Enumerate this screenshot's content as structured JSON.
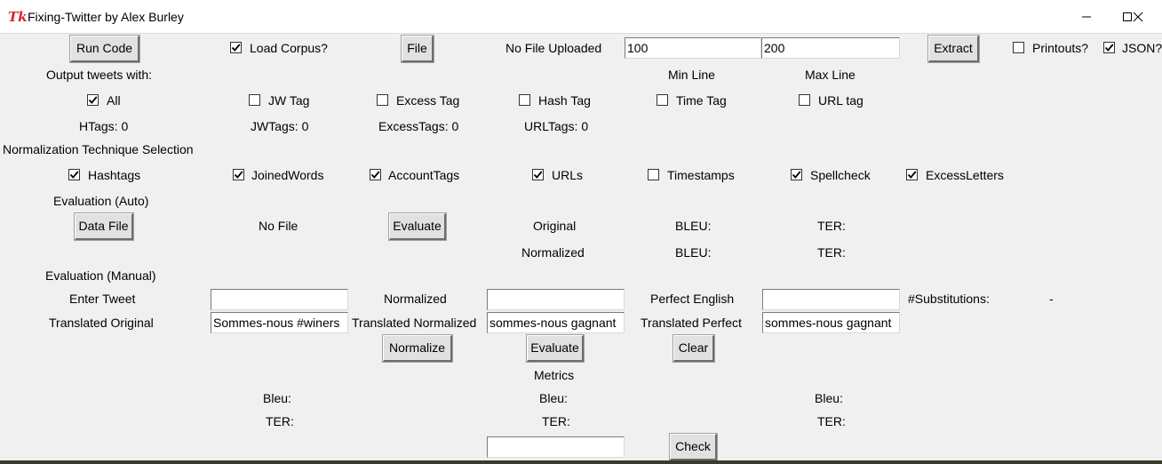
{
  "window": {
    "logo": "Tk",
    "title": "Fixing-Twitter by Alex Burley"
  },
  "row1": {
    "run_code": "Run Code",
    "load_corpus": "Load Corpus?",
    "file_btn": "File",
    "file_status": "No File Uploaded",
    "min_line_value": "100",
    "max_line_value": "200",
    "extract": "Extract",
    "printouts": "Printouts?",
    "json": "JSON?"
  },
  "row2": {
    "output_with": "Output tweets with:",
    "min_line": "Min Line",
    "max_line": "Max Line"
  },
  "tags": {
    "all": "All",
    "jw": "JW Tag",
    "excess": "Excess Tag",
    "hash": "Hash Tag",
    "time": "Time Tag",
    "url": "URL tag"
  },
  "counts": {
    "htags": "HTags: 0",
    "jwtags": "JWTags: 0",
    "excesstags": "ExcessTags: 0",
    "urltags": "URLTags: 0"
  },
  "normalization": {
    "heading": "Normalization Technique Selection",
    "hashtags": "Hashtags",
    "joinedwords": "JoinedWords",
    "accounttags": "AccountTags",
    "urls": "URLs",
    "timestamps": "Timestamps",
    "spellcheck": "Spellcheck",
    "excessletters": "ExcessLetters"
  },
  "eval_auto": {
    "heading": "Evaluation (Auto)",
    "data_file": "Data File",
    "no_file": "No File",
    "evaluate": "Evaluate",
    "original": "Original",
    "normalized": "Normalized",
    "bleu": "BLEU:",
    "ter": "TER:"
  },
  "eval_manual": {
    "heading": "Evaluation (Manual)",
    "enter_tweet": "Enter Tweet",
    "normalized": "Normalized",
    "perfect_english": "Perfect English",
    "substitutions": "#Substitutions:",
    "substitutions_value": "-",
    "translated_original": "Translated Original",
    "translated_original_value": "Sommes-nous #winers",
    "translated_normalized": "Translated Normalized",
    "translated_normalized_value": "sommes-nous gagnant",
    "translated_perfect": "Translated Perfect",
    "translated_perfect_value": "sommes-nous gagnant",
    "normalize_btn": "Normalize",
    "evaluate_btn": "Evaluate",
    "clear_btn": "Clear"
  },
  "metrics": {
    "heading": "Metrics",
    "bleu": "Bleu:",
    "ter": "TER:",
    "check": "Check"
  },
  "checkbox_states": {
    "load_corpus": true,
    "printouts": false,
    "json": true,
    "all": true,
    "jw": false,
    "excess": false,
    "hash": false,
    "time": false,
    "url": false,
    "hashtags": true,
    "joinedwords": true,
    "accounttags": true,
    "urls": true,
    "timestamps": false,
    "spellcheck": true,
    "excessletters": true
  }
}
